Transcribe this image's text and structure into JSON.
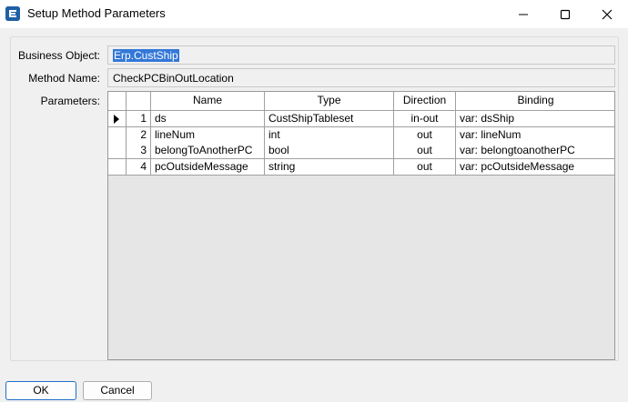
{
  "window": {
    "title": "Setup Method Parameters",
    "icon": "epicor-e-icon",
    "controls": [
      "minimize-icon",
      "maximize-icon",
      "close-icon"
    ]
  },
  "form": {
    "business_object_label": "Business Object:",
    "business_object_value": "Erp.CustShip",
    "method_name_label": "Method Name:",
    "method_name_value": "CheckPCBinOutLocation",
    "parameters_label": "Parameters:"
  },
  "grid": {
    "columns": [
      "Name",
      "Type",
      "Direction",
      "Binding"
    ],
    "rows": [
      {
        "index": "1",
        "name": "ds",
        "type": "CustShipTableset",
        "direction": "in-out",
        "binding": "var: dsShip",
        "current": true
      },
      {
        "index": "2",
        "name": "lineNum",
        "type": "int",
        "direction": "out",
        "binding": "var: lineNum",
        "current": false
      },
      {
        "index": "3",
        "name": "belongToAnotherPC",
        "type": "bool",
        "direction": "out",
        "binding": "var: belongtoanotherPC",
        "current": false
      },
      {
        "index": "4",
        "name": "pcOutsideMessage",
        "type": "string",
        "direction": "out",
        "binding": "var: pcOutsideMessage",
        "current": false
      }
    ]
  },
  "buttons": {
    "ok_label": "OK",
    "cancel_label": "Cancel"
  },
  "colors": {
    "selection": "#3378d7",
    "icon_blue": "#1f5fa3"
  }
}
